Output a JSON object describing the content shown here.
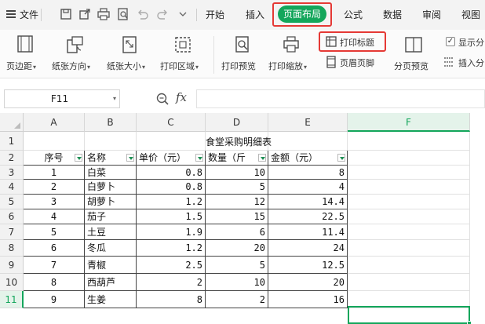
{
  "menubar": {
    "file_label": "文件",
    "tabs": [
      "开始",
      "插入",
      "页面布局",
      "公式",
      "数据",
      "审阅",
      "视图"
    ],
    "active_tab": "页面布局",
    "quick_access_icons": [
      "save-icon",
      "export-icon",
      "print-icon",
      "print-preview-icon",
      "undo-icon",
      "redo-icon",
      "dropdown-icon"
    ]
  },
  "ribbon": {
    "margins": "页边距",
    "orientation": "纸张方向",
    "size": "纸张大小",
    "print_area": "打印区域",
    "print_preview": "打印预览",
    "print_scale": "打印缩放",
    "print_titles": "打印标题",
    "header_footer": "页眉页脚",
    "page_break_preview": "分页预览",
    "show_page_breaks": "显示分",
    "insert_page_break": "插入分"
  },
  "formula_bar": {
    "name_box": "F11",
    "fx_label": "fx",
    "formula_value": ""
  },
  "colors": {
    "accent_green": "#13a65b",
    "highlight_red": "#e53935"
  },
  "grid": {
    "columns": [
      "A",
      "B",
      "C",
      "D",
      "E",
      "F"
    ],
    "selected_column": "F",
    "selected_row": "11",
    "rows": [
      "1",
      "2",
      "3",
      "4",
      "5",
      "6",
      "7",
      "8",
      "9",
      "10",
      "11"
    ],
    "sheet_title": "食堂采购明细表",
    "headers": [
      "序号",
      "名称",
      "单价（元）",
      "数量（斤",
      "金额（元）"
    ],
    "data_rows": [
      [
        "1",
        "白菜",
        "0.8",
        "10",
        "8"
      ],
      [
        "2",
        "白萝卜",
        "0.8",
        "5",
        "4"
      ],
      [
        "3",
        "胡萝卜",
        "1.2",
        "12",
        "14.4"
      ],
      [
        "4",
        "茄子",
        "1.5",
        "15",
        "22.5"
      ],
      [
        "5",
        "土豆",
        "1.9",
        "6",
        "11.4"
      ],
      [
        "6",
        "冬瓜",
        "1.2",
        "20",
        "24"
      ],
      [
        "7",
        "青椒",
        "2.5",
        "5",
        "12.5"
      ],
      [
        "8",
        "西葫芦",
        "2",
        "10",
        "20"
      ],
      [
        "9",
        "生姜",
        "8",
        "2",
        "16"
      ]
    ]
  }
}
